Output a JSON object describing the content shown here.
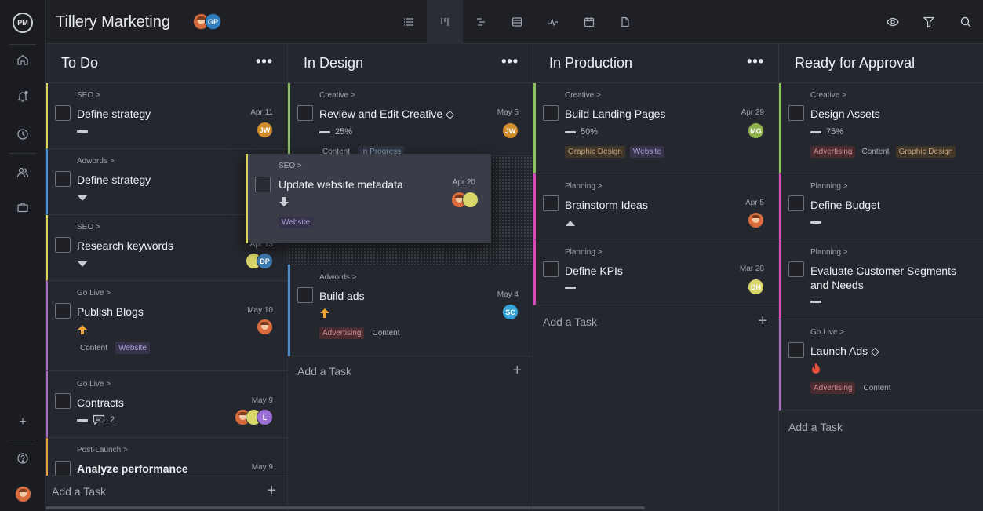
{
  "app": {
    "logo": "PM",
    "project_title": "Tillery Marketing",
    "members": [
      "GP"
    ]
  },
  "sidebar": {
    "icons": [
      "home-icon",
      "notification-bell-icon",
      "clock-icon",
      "people-icon",
      "briefcase-icon",
      "plus-icon",
      "help-icon",
      "user-avatar"
    ]
  },
  "toolbar": {
    "views": [
      "list-view-icon",
      "board-view-icon",
      "gantt-view-icon",
      "sheet-view-icon",
      "dashboard-view-icon",
      "calendar-view-icon",
      "document-view-icon"
    ],
    "right": [
      "eye-icon",
      "filter-icon",
      "search-icon"
    ]
  },
  "colors": {
    "seo": "#d6d45c",
    "adwords": "#4a8fd6",
    "golive": "#a86cc1",
    "postlaunch": "#e2a13a",
    "creative": "#8bc25a",
    "planning": "#d64ab7"
  },
  "columns": [
    {
      "title": "To Do",
      "menu": "•••",
      "add_task": "Add a Task",
      "add_plus": "+",
      "cards": [
        {
          "category": "SEO >",
          "name": "Define strategy",
          "date": "Apr 11",
          "avatar": "JW"
        },
        {
          "category": "Adwords >",
          "name": "Define strategy"
        },
        {
          "category": "SEO >",
          "name": "Research keywords",
          "date": "Apr 13",
          "avatar": "DP"
        },
        {
          "category": "Go Live >",
          "name": "Publish Blogs",
          "date": "May 10",
          "tags": [
            "Content",
            "Website"
          ]
        },
        {
          "category": "Go Live >",
          "name": "Contracts",
          "date": "May 9",
          "comments": "2",
          "avatar": "L"
        },
        {
          "category": "Post-Launch >",
          "name": "Analyze performance",
          "date": "May 9"
        }
      ]
    },
    {
      "title": "In Design",
      "menu": "•••",
      "add_task": "Add a Task",
      "add_plus": "+",
      "cards": [
        {
          "category": "Creative >",
          "name": "Review and Edit Creative ◇",
          "date": "May 5",
          "progress": "25%",
          "avatar": "JW",
          "tags": [
            "Content",
            "In Progress"
          ]
        },
        {
          "category": "Adwords >",
          "name": "Build ads",
          "date": "May 4",
          "avatar": "SC",
          "tags": [
            "Advertising",
            "Content"
          ]
        }
      ]
    },
    {
      "title": "In Production",
      "menu": "•••",
      "add_task": "Add a Task",
      "add_plus": "+",
      "cards": [
        {
          "category": "Creative >",
          "name": "Build Landing Pages",
          "date": "Apr 29",
          "progress": "50%",
          "avatar": "MG",
          "tags": [
            "Graphic Design",
            "Website"
          ]
        },
        {
          "category": "Planning >",
          "name": "Brainstorm Ideas",
          "date": "Apr 5"
        },
        {
          "category": "Planning >",
          "name": "Define KPIs",
          "date": "Mar 28",
          "avatar": "DH"
        }
      ]
    },
    {
      "title": "Ready for Approval",
      "add_task": "Add a Task",
      "cards": [
        {
          "category": "Creative >",
          "name": "Design Assets",
          "progress": "75%",
          "tags": [
            "Advertising",
            "Content",
            "Graphic Design"
          ]
        },
        {
          "category": "Planning >",
          "name": "Define Budget"
        },
        {
          "category": "Planning >",
          "name": "Evaluate Customer Segments and Needs"
        },
        {
          "category": "Go Live >",
          "name": "Launch Ads ◇",
          "tags": [
            "Advertising",
            "Content"
          ]
        }
      ]
    }
  ],
  "dragging": {
    "category": "SEO >",
    "name": "Update website metadata",
    "date": "Apr 20",
    "tag": "Website"
  }
}
